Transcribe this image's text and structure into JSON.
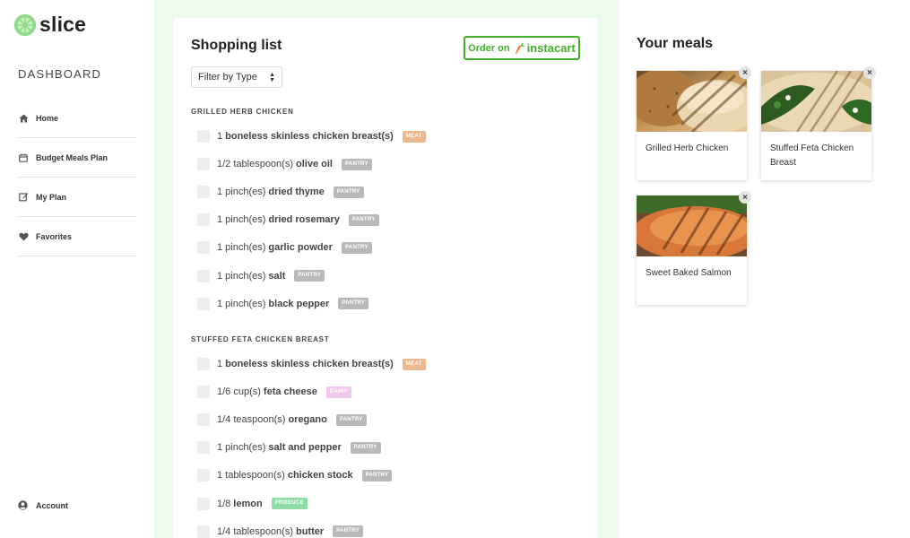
{
  "app": {
    "name": "slice",
    "accent": "#43b02a"
  },
  "sidebar": {
    "title": "DASHBOARD",
    "items": [
      {
        "label": "Home",
        "icon": "home-icon"
      },
      {
        "label": "Budget Meals Plan",
        "icon": "calendar-icon"
      },
      {
        "label": "My Plan",
        "icon": "edit-icon"
      },
      {
        "label": "Favorites",
        "icon": "heart-icon"
      }
    ],
    "account": {
      "label": "Account",
      "icon": "user-circle-icon"
    }
  },
  "shopping": {
    "title": "Shopping list",
    "order_prefix": "Order on",
    "order_brand": "instacart",
    "filter": "Filter by Type",
    "sections": [
      {
        "title": "GRILLED HERB CHICKEN",
        "items": [
          {
            "qty": "1",
            "name": "boneless skinless chicken breast(s)",
            "type": "MEAT"
          },
          {
            "qty": "1/2 tablespoon(s)",
            "name": "olive oil",
            "type": "PANTRY"
          },
          {
            "qty": "1 pinch(es)",
            "name": "dried thyme",
            "type": "PANTRY"
          },
          {
            "qty": "1 pinch(es)",
            "name": "dried rosemary",
            "type": "PANTRY"
          },
          {
            "qty": "1 pinch(es)",
            "name": "garlic powder",
            "type": "PANTRY"
          },
          {
            "qty": "1 pinch(es)",
            "name": "salt",
            "type": "PANTRY"
          },
          {
            "qty": "1 pinch(es)",
            "name": "black pepper",
            "type": "PANTRY"
          }
        ]
      },
      {
        "title": "STUFFED FETA CHICKEN BREAST",
        "items": [
          {
            "qty": "1",
            "name": "boneless skinless chicken breast(s)",
            "type": "MEAT"
          },
          {
            "qty": "1/6 cup(s)",
            "name": "feta cheese",
            "type": "DAIRY"
          },
          {
            "qty": "1/4 teaspoon(s)",
            "name": "oregano",
            "type": "PANTRY"
          },
          {
            "qty": "1 pinch(es)",
            "name": "salt and pepper",
            "type": "PANTRY"
          },
          {
            "qty": "1 tablespoon(s)",
            "name": "chicken stock",
            "type": "PANTRY"
          },
          {
            "qty": "1/8",
            "name": "lemon",
            "type": "PRODUCE"
          },
          {
            "qty": "1/4 tablespoon(s)",
            "name": "butter",
            "type": "PANTRY"
          }
        ]
      }
    ],
    "badge_colors": {
      "MEAT": "#eab98f",
      "PANTRY": "#b9b9b9",
      "DAIRY": "#f3c8ef",
      "PRODUCE": "#8fdca6"
    }
  },
  "meals": {
    "title": "Your meals",
    "remove_label": "×",
    "items": [
      {
        "name": "Grilled Herb Chicken",
        "image": "grilled-chicken-photo"
      },
      {
        "name": "Stuffed Feta Chicken Breast",
        "image": "stuffed-chicken-photo"
      },
      {
        "name": "Sweet Baked Salmon",
        "image": "salmon-photo"
      }
    ]
  }
}
